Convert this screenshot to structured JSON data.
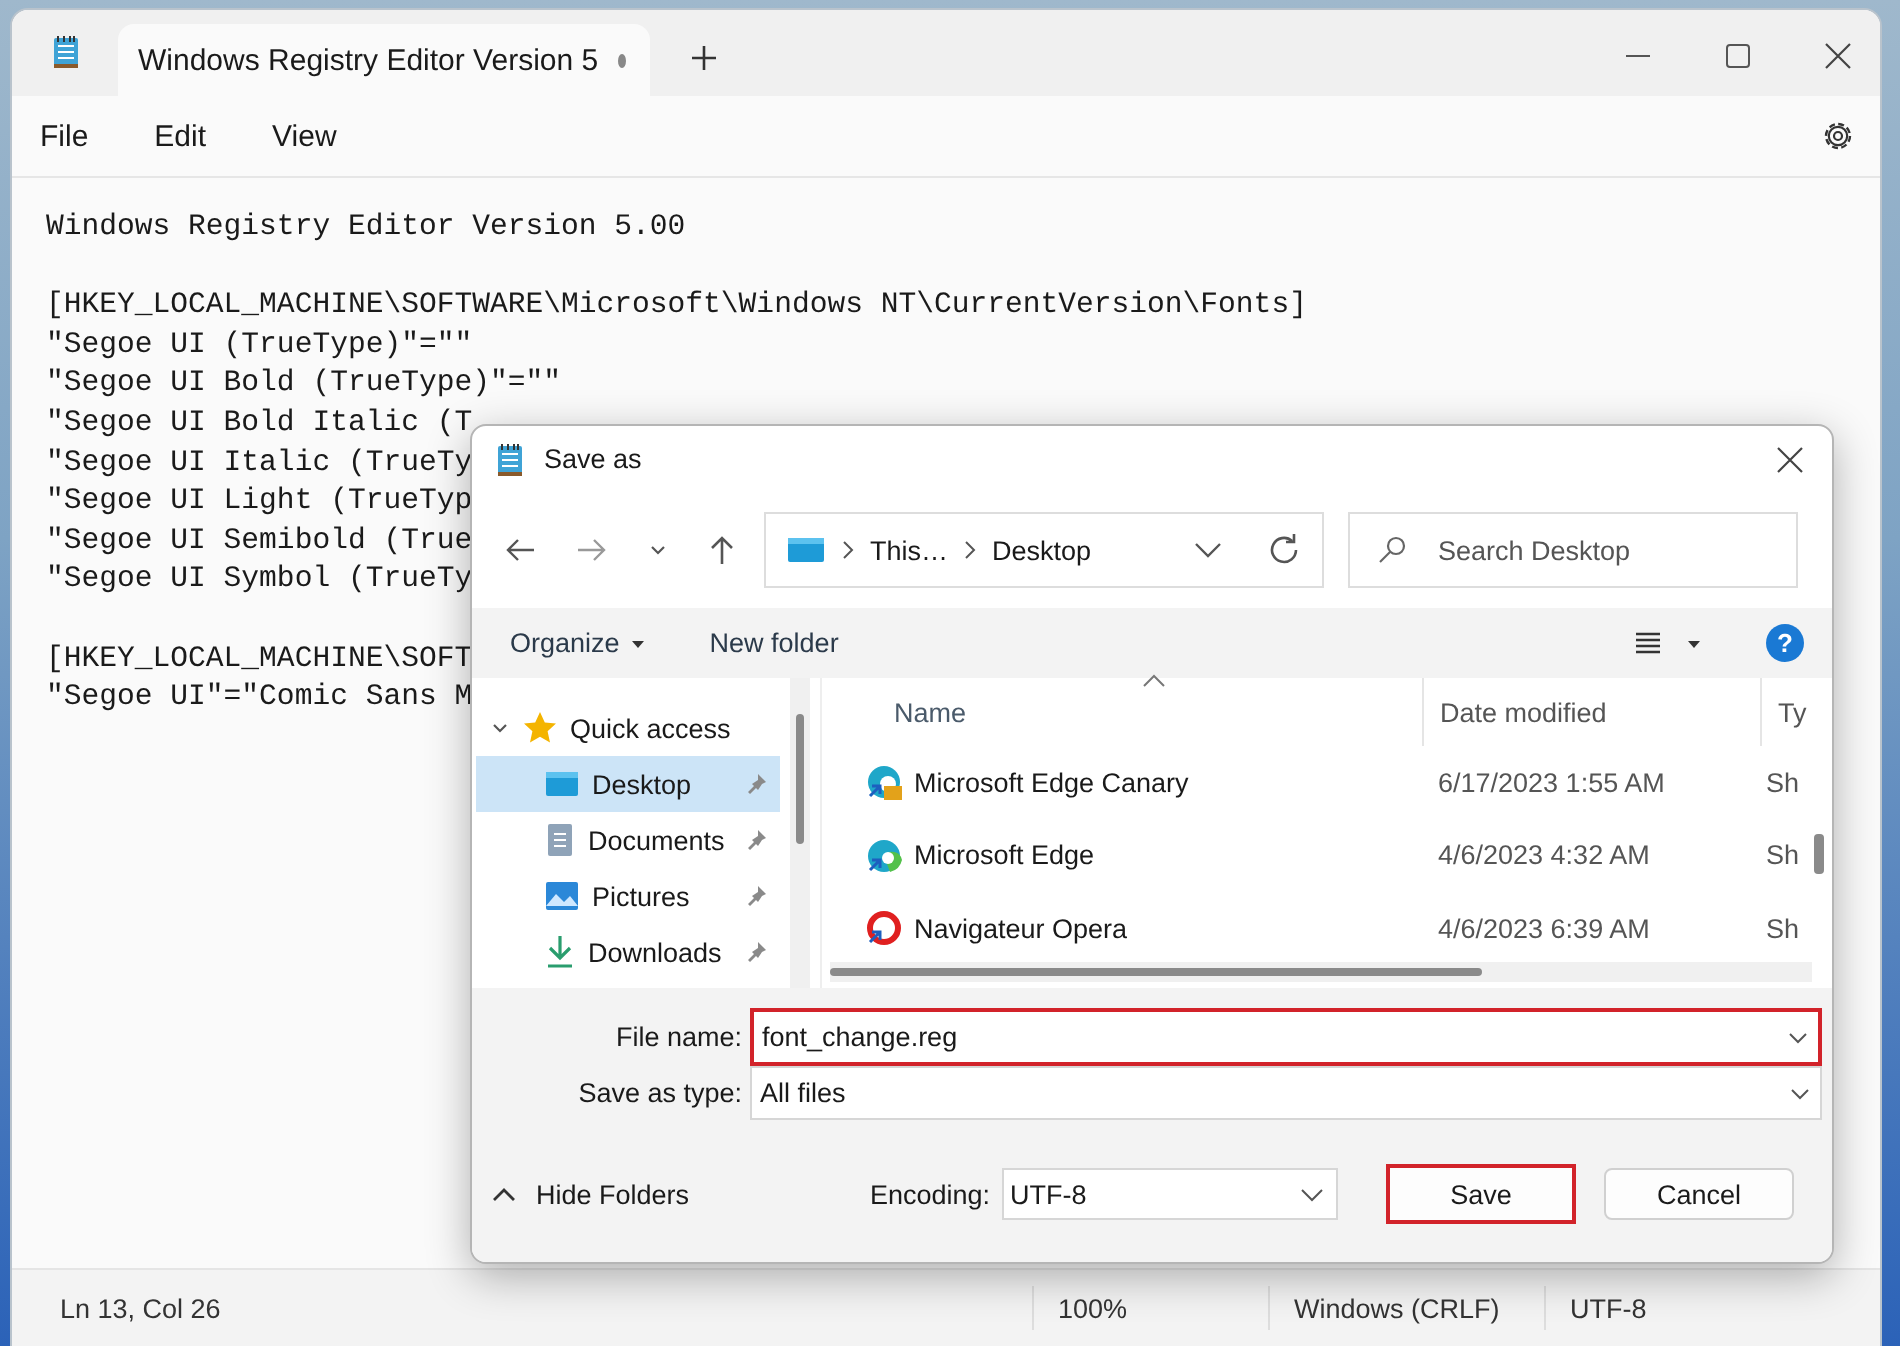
{
  "notepad": {
    "tab_title": "Windows Registry Editor Version 5",
    "tab_modified": true,
    "menu": [
      "File",
      "Edit",
      "View"
    ],
    "blocks": [
      [
        "Windows Registry Editor Version 5.00"
      ],
      [
        "[HKEY_LOCAL_MACHINE\\SOFTWARE\\Microsoft\\Windows NT\\CurrentVersion\\Fonts]",
        "\"Segoe UI (TrueType)\"=\"\"",
        "\"Segoe UI Bold (TrueType)\"=\"\"",
        "\"Segoe UI Bold Italic (T",
        "\"Segoe UI Italic (TrueTy",
        "\"Segoe UI Light (TrueTyp",
        "\"Segoe UI Semibold (True",
        "\"Segoe UI Symbol (TrueTy"
      ],
      [
        "[HKEY_LOCAL_MACHINE\\SOFT",
        "\"Segoe UI\"=\"Comic Sans M"
      ]
    ],
    "status_bar": {
      "position": "Ln 13, Col 26",
      "zoom": "100%",
      "line_ending": "Windows (CRLF)",
      "encoding": "UTF-8"
    }
  },
  "dialog": {
    "title": "Save as",
    "breadcrumb": [
      "This…",
      "Desktop"
    ],
    "search": {
      "placeholder": "Search Desktop"
    },
    "toolbar": {
      "organize": "Organize",
      "new_folder": "New folder",
      "help": "?"
    },
    "nav": [
      {
        "label": "Quick access",
        "expanded": true,
        "children": [
          {
            "label": "Desktop",
            "kind": "desktop",
            "pinned": true,
            "selected": true
          },
          {
            "label": "Documents",
            "kind": "documents",
            "pinned": true,
            "selected": false
          },
          {
            "label": "Pictures",
            "kind": "pictures",
            "pinned": true,
            "selected": false
          },
          {
            "label": "Downloads",
            "kind": "downloads",
            "pinned": true,
            "selected": false
          }
        ]
      }
    ],
    "columns": [
      "Name",
      "Date modified",
      "Ty"
    ],
    "rows": [
      {
        "name": "Microsoft Edge Canary",
        "kind": "edge-canary",
        "date": "6/17/2023 1:55 AM",
        "type": "Sh"
      },
      {
        "name": "Microsoft Edge",
        "kind": "edge",
        "date": "4/6/2023 4:32 AM",
        "type": "Sh"
      },
      {
        "name": "Navigateur Opera",
        "kind": "opera",
        "date": "4/6/2023 6:39 AM",
        "type": "Sh"
      }
    ],
    "file_name": {
      "label": "File name:",
      "value": "font_change.reg",
      "highlighted": true
    },
    "save_as_type": {
      "label": "Save as type:",
      "value": "All files"
    },
    "hide_folders": "Hide Folders",
    "encoding": {
      "label": "Encoding:",
      "value": "UTF-8"
    },
    "buttons": [
      {
        "label": "Save",
        "highlighted": true
      },
      {
        "label": "Cancel",
        "highlighted": false
      }
    ]
  }
}
